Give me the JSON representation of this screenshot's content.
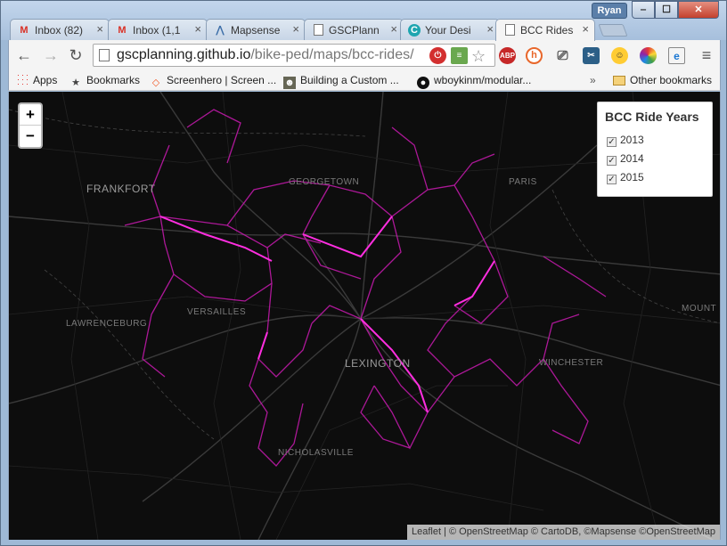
{
  "window": {
    "user_name": "Ryan",
    "controls": {
      "minimize": "‒",
      "maximize": "☐",
      "close": "✕"
    }
  },
  "tabs": [
    {
      "label": "Inbox (82)",
      "icon": "gmail-icon",
      "active": false
    },
    {
      "label": "Inbox (1,1",
      "icon": "gmail-icon",
      "active": false
    },
    {
      "label": "Mapsense",
      "icon": "mapsense-icon",
      "active": false
    },
    {
      "label": "GSCPlann",
      "icon": "document-icon",
      "active": false
    },
    {
      "label": "Your Desi",
      "icon": "canva-icon",
      "active": false
    },
    {
      "label": "BCC Rides",
      "icon": "document-icon",
      "active": true
    }
  ],
  "toolbar": {
    "url_host": "gscplanning.github.io",
    "url_path": "/bike-ped/maps/bcc-rides/",
    "extensions": [
      "lastpass-icon",
      "evernote-icon",
      "adblock-icon",
      "honey-icon",
      "cast-icon",
      "tool-icon",
      "emoji-icon",
      "color-icon",
      "ie-tab-icon"
    ],
    "adblock_label": "ABP"
  },
  "bookmarks": [
    {
      "label": "Apps",
      "icon": "apps-icon"
    },
    {
      "label": "Bookmarks",
      "icon": "star-icon"
    },
    {
      "label": "Screenhero | Screen ...",
      "icon": "screenhero-icon"
    },
    {
      "label": "Building a Custom ...",
      "icon": "avatar-icon"
    },
    {
      "label": "wboykinm/modular...",
      "icon": "github-icon"
    }
  ],
  "other_bookmarks": "Other bookmarks",
  "map": {
    "zoom_in": "+",
    "zoom_out": "−",
    "legend_title": "BCC Ride Years",
    "years": [
      {
        "label": "2013",
        "checked": true
      },
      {
        "label": "2014",
        "checked": true
      },
      {
        "label": "2015",
        "checked": true
      }
    ],
    "cities": [
      {
        "name": "FRANKFORT",
        "big": true
      },
      {
        "name": "GEORGETOWN",
        "big": false
      },
      {
        "name": "PARIS",
        "big": false
      },
      {
        "name": "VERSAILLES",
        "big": false
      },
      {
        "name": "LAWRENCEBURG",
        "big": false
      },
      {
        "name": "LEXINGTON",
        "big": true
      },
      {
        "name": "WINCHESTER",
        "big": false
      },
      {
        "name": "MOUNT",
        "big": false
      },
      {
        "name": "NICHOLASVILLE",
        "big": false
      }
    ],
    "route_color": "#e21cc7",
    "attribution": "Leaflet | © OpenStreetMap © CartoDB, ©Mapsense ©OpenStreetMap"
  }
}
